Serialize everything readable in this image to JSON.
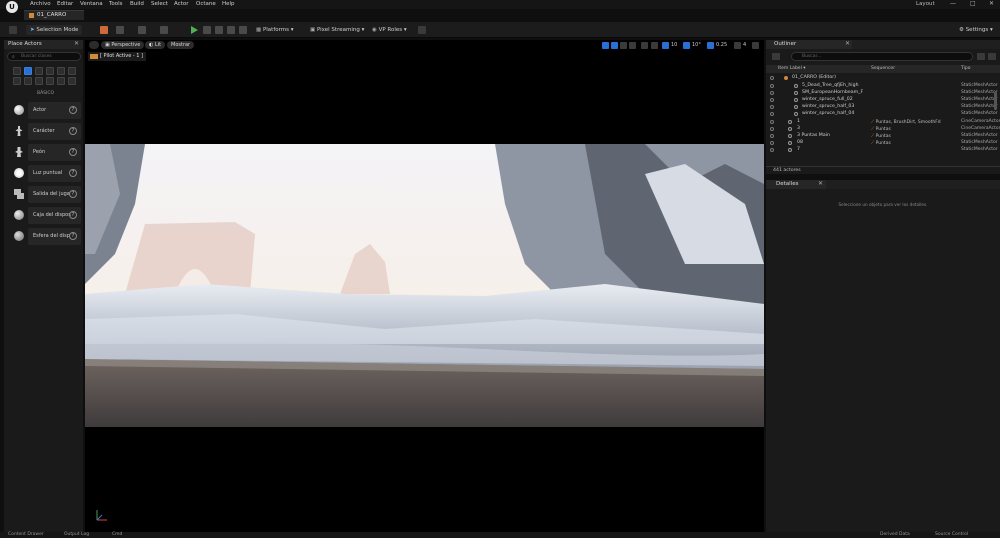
{
  "menubar": {
    "logo": "U",
    "items": [
      "Archivo",
      "Editar",
      "Ventana",
      "Tools",
      "Build",
      "Select",
      "Actor",
      "Octane",
      "Help"
    ],
    "layout_label": "Layout",
    "win_min": "—",
    "win_max": "□",
    "win_close": "✕"
  },
  "doc_tab": {
    "label": "01_CARRO"
  },
  "toolbar": {
    "selection_mode": "Selection Mode",
    "platforms": "Platforms",
    "pixel_streaming": "Pixel Streaming",
    "vp_roles": "VP Roles",
    "settings": "Settings",
    "colors": {
      "play_green": "#4fb04f",
      "accent_blue": "#2a6fd6",
      "orange": "#d08a3a"
    }
  },
  "place_actors": {
    "title": "Place Actors",
    "close": "✕",
    "search_placeholder": "Buscar clases",
    "category_label": "BÁSICO",
    "items": [
      {
        "label": "Actor",
        "icon": "actor-sphere-icon"
      },
      {
        "label": "Carácter",
        "icon": "character-icon"
      },
      {
        "label": "Peón",
        "icon": "pawn-icon"
      },
      {
        "label": "Luz puntual",
        "icon": "point-light-icon"
      },
      {
        "label": "Salida del juga",
        "icon": "player-start-icon"
      },
      {
        "label": "Caja del dispos",
        "icon": "trigger-box-icon"
      },
      {
        "label": "Esfera del disp",
        "icon": "trigger-sphere-icon"
      }
    ],
    "help": "?"
  },
  "viewport": {
    "perspective": "Perspective",
    "lit": "Lit",
    "mostrar": "Mostrar",
    "pilot": "[ Pilot Active - 1 ]",
    "grid_value": "10",
    "angle_value": "10°",
    "scale_value": "0.25",
    "camera_speed": "4"
  },
  "outliner": {
    "title": "Outliner",
    "close": "✕",
    "search_placeholder": "Buscar...",
    "col_item": "Item Label ▾",
    "col_sequencer": "Sequencer",
    "col_type": "Tipo",
    "rows": [
      {
        "name": "01_CARRO (Editor)",
        "seq": "",
        "type": "",
        "indent": 1
      },
      {
        "name": "5_Dead_Tree_qfjEh_high",
        "seq": "",
        "type": "StaticMeshActor",
        "indent": 3
      },
      {
        "name": "SM_EuropeanHornbeam_F",
        "seq": "",
        "type": "StaticMeshActor",
        "indent": 3
      },
      {
        "name": "winter_spruce_full_02",
        "seq": "",
        "type": "StaticMeshActor",
        "indent": 3
      },
      {
        "name": "winter_spruce_half_03",
        "seq": "",
        "type": "StaticMeshActor",
        "indent": 3
      },
      {
        "name": "winter_spruce_half_04",
        "seq": "",
        "type": "StaticMeshActor",
        "indent": 3
      },
      {
        "name": "1",
        "seq": "Puntas, BrushDirt, SmoothFd",
        "type": "CineCameraActor",
        "indent": 2
      },
      {
        "name": "3",
        "seq": "Puntas",
        "type": "CineCameraActor",
        "indent": 2
      },
      {
        "name": "3 Puntas Main",
        "seq": "Puntas",
        "type": "StaticMeshActor",
        "indent": 2
      },
      {
        "name": "08",
        "seq": "Puntas",
        "type": "StaticMeshActor",
        "indent": 2
      },
      {
        "name": "7",
        "seq": "",
        "type": "StaticMeshActor",
        "indent": 2
      }
    ],
    "count": "441 actores"
  },
  "details": {
    "title": "Detalles",
    "close": "✕",
    "empty": "Seleccione un objeto para ver los detalles."
  },
  "statusbar": {
    "items": [
      "Content Drawer",
      "Output Log",
      "Cmd"
    ],
    "right": [
      "Derived Data",
      "Source Control"
    ]
  }
}
